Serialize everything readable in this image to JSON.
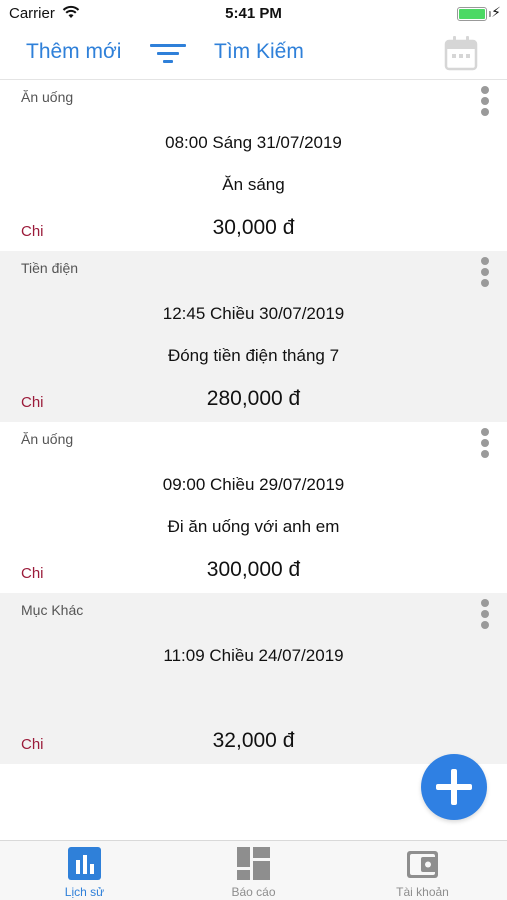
{
  "status_bar": {
    "carrier": "Carrier",
    "time": "5:41 PM",
    "battery_level": 1.0
  },
  "nav": {
    "add_label": "Thêm mới",
    "search_label": "Tìm Kiếm",
    "accent_color": "#2f80d9"
  },
  "entries": [
    {
      "category": "Ăn uống",
      "datetime": "08:00 Sáng 31/07/2019",
      "note": "Ăn sáng",
      "type": "Chi",
      "amount": "30,000 đ"
    },
    {
      "category": "Tiền điện",
      "datetime": "12:45 Chiều 30/07/2019",
      "note": "Đóng tiền điện tháng 7",
      "type": "Chi",
      "amount": "280,000 đ"
    },
    {
      "category": "Ăn uống",
      "datetime": "09:00 Chiều 29/07/2019",
      "note": "Đi ăn uống với anh em",
      "type": "Chi",
      "amount": "300,000 đ"
    },
    {
      "category": "Mục Khác",
      "datetime": "11:09 Chiều 24/07/2019",
      "note": "",
      "type": "Chi",
      "amount": "32,000 đ"
    }
  ],
  "tabs": [
    {
      "label": "Lịch sử",
      "icon": "bar-chart-icon",
      "active": true
    },
    {
      "label": "Báo cáo",
      "icon": "report-grid-icon",
      "active": false
    },
    {
      "label": "Tài khoản",
      "icon": "wallet-icon",
      "active": false
    }
  ],
  "colors": {
    "expense": "#9b1b3a",
    "fab": "#2f80e3",
    "row_alt": "#f2f2f2",
    "icon_gray": "#9a9a9a"
  }
}
